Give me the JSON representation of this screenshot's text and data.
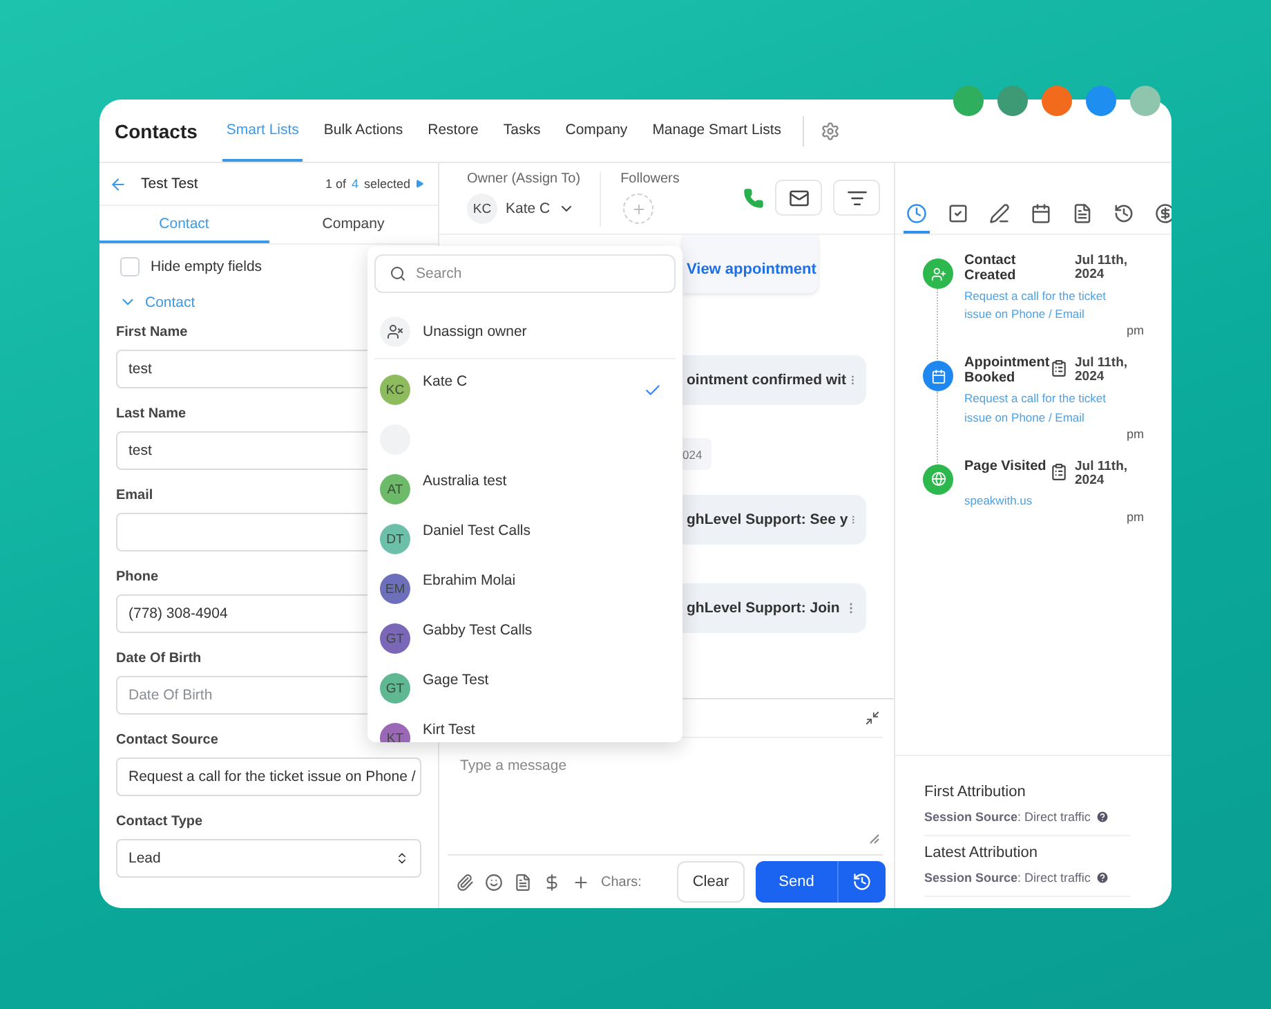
{
  "top_avatars": [
    {
      "color": "#2fae5e"
    },
    {
      "color": "#3d9a74"
    },
    {
      "color": "#f26a1b"
    },
    {
      "color": "#1f8ef1"
    },
    {
      "color": "#8fc5ac"
    }
  ],
  "nav": {
    "title": "Contacts",
    "tabs": [
      {
        "label": "Smart Lists",
        "selected": true
      },
      {
        "label": "Bulk Actions",
        "selected": false
      },
      {
        "label": "Restore",
        "selected": false
      },
      {
        "label": "Tasks",
        "selected": false
      },
      {
        "label": "Company",
        "selected": false
      },
      {
        "label": "Manage Smart Lists",
        "selected": false
      }
    ]
  },
  "record": {
    "name": "Test Test",
    "pager_prefix": "1 of",
    "pager_count": "4",
    "pager_suffix": "selected"
  },
  "detail_tabs": [
    {
      "label": "Contact",
      "selected": true
    },
    {
      "label": "Company",
      "selected": false
    }
  ],
  "hide_empty": {
    "label": "Hide empty fields",
    "checked": false
  },
  "section": {
    "label": "Contact",
    "expanded": true
  },
  "fields": [
    {
      "kind": "text",
      "label": "First Name",
      "value": "test"
    },
    {
      "kind": "text",
      "label": "Last Name",
      "value": "test"
    },
    {
      "kind": "text",
      "label": "Email"
    },
    {
      "kind": "text",
      "label": "Phone",
      "value": "(778) 308-4904"
    },
    {
      "kind": "text",
      "label": "Date Of Birth",
      "placeholder": "Date Of Birth"
    },
    {
      "kind": "text",
      "label": "Contact Source",
      "value": "Request a call for the ticket issue on Phone /"
    },
    {
      "kind": "select",
      "label": "Contact Type",
      "value": "Lead"
    }
  ],
  "owner": {
    "label": "Owner (Assign To)",
    "initials": "KC",
    "name": "Kate C"
  },
  "followers": {
    "label": "Followers"
  },
  "chat": [
    {
      "kind": "link",
      "text": "View appointment"
    },
    {
      "kind": "bubble",
      "text": "ointment confirmed wit"
    },
    {
      "kind": "date",
      "text": "024"
    },
    {
      "kind": "bubble",
      "text": "ghLevel Support: See y"
    },
    {
      "kind": "bubble",
      "text": "ghLevel Support: Join"
    }
  ],
  "owner_menu": {
    "search": {
      "placeholder": "Search"
    },
    "unassign": "Unassign owner",
    "users": [
      {
        "kind": "user",
        "initials": "KC",
        "name": "Kate C",
        "color": "#8dbb5e",
        "selected": true
      },
      {
        "kind": "blank",
        "selected": false
      },
      {
        "kind": "user",
        "initials": "AT",
        "name": "Australia test",
        "color": "#6dbb6a",
        "selected": false
      },
      {
        "kind": "user",
        "initials": "DT",
        "name": "Daniel Test Calls",
        "color": "#6cbfa8",
        "selected": false
      },
      {
        "kind": "user",
        "initials": "EM",
        "name": "Ebrahim Molai",
        "color": "#6e6fba",
        "selected": false
      },
      {
        "kind": "user",
        "initials": "GT",
        "name": "Gabby Test Calls",
        "color": "#7a67b8",
        "selected": false
      },
      {
        "kind": "user",
        "initials": "GT",
        "name": "Gage Test",
        "color": "#5fb892",
        "selected": false
      },
      {
        "kind": "user",
        "initials": "KT",
        "name": "Kirt Test",
        "color": "#9b68b7",
        "selected": false
      }
    ]
  },
  "composer": {
    "placeholder": "Type a message",
    "chars": "Chars:",
    "clear": "Clear",
    "send": "Send"
  },
  "activity_tabs": [
    {
      "kind": "activity",
      "selected": true
    },
    {
      "kind": "task",
      "selected": false
    },
    {
      "kind": "note",
      "selected": false
    },
    {
      "kind": "calendar",
      "selected": false
    },
    {
      "kind": "document",
      "selected": false
    },
    {
      "kind": "history",
      "selected": false
    },
    {
      "kind": "payment",
      "selected": false
    }
  ],
  "timeline": [
    {
      "kind": "contact",
      "title": "Contact Created",
      "date": "Jul 11th, 2024",
      "link": "Request a call for the ticket issue on Phone / Email",
      "time": "pm",
      "color": "#2db84d",
      "note": false
    },
    {
      "kind": "appointment",
      "title": "Appointment Booked",
      "date": "Jul 11th, 2024",
      "link": "Request a call for the ticket issue on Phone / Email",
      "time": "pm",
      "color": "#1e88f0",
      "note": true
    },
    {
      "kind": "page",
      "title": "Page Visited",
      "date": "Jul 11th, 2024",
      "link": "speakwith.us",
      "time": "pm",
      "color": "#2db84d",
      "note": true
    }
  ],
  "attribution": [
    {
      "title": "First Attribution",
      "text": "**Session Source**: Direct traffic"
    },
    {
      "title": "Latest Attribution",
      "text": "**Session Source**: Direct traffic"
    }
  ]
}
